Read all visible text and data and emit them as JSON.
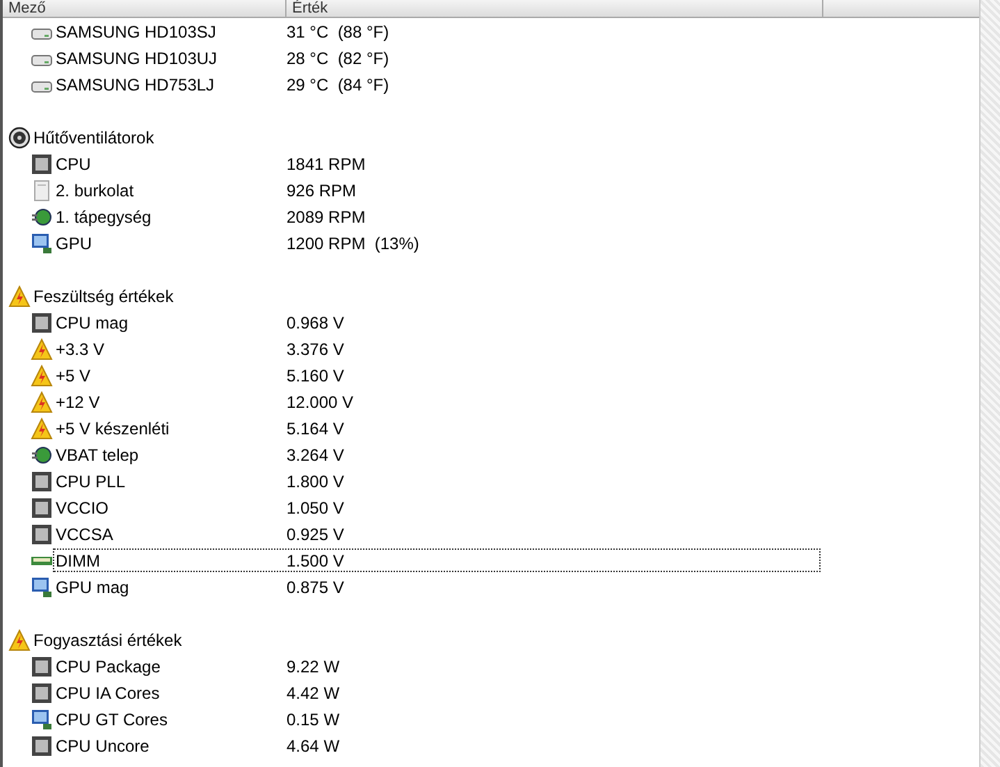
{
  "columns": [
    "Mező",
    "Érték"
  ],
  "groups": [
    {
      "items": [
        {
          "kind": "drive",
          "name": "SAMSUNG HD103SJ",
          "value": "31 °C  (88 °F)",
          "focused": false
        },
        {
          "kind": "drive",
          "name": "SAMSUNG HD103UJ",
          "value": "28 °C  (82 °F)",
          "focused": false
        },
        {
          "kind": "drive",
          "name": "SAMSUNG HD753LJ",
          "value": "29 °C  (84 °F)",
          "focused": false
        }
      ]
    },
    {
      "kind": "fan",
      "label": "Hűtőventilátorok",
      "items": [
        {
          "kind": "chip",
          "name": "CPU",
          "value": "1841 RPM",
          "focused": false
        },
        {
          "kind": "case",
          "name": "2. burkolat",
          "value": "926 RPM",
          "focused": false
        },
        {
          "kind": "plug",
          "name": "1. tápegység",
          "value": "2089 RPM",
          "focused": false
        },
        {
          "kind": "monitor",
          "name": "GPU",
          "value": "1200 RPM  (13%)",
          "focused": false
        }
      ]
    },
    {
      "kind": "warning",
      "label": "Feszültség értékek",
      "items": [
        {
          "kind": "chip",
          "name": "CPU mag",
          "value": "0.968 V",
          "focused": false
        },
        {
          "kind": "warning",
          "name": "+3.3 V",
          "value": "3.376 V",
          "focused": false
        },
        {
          "kind": "warning",
          "name": "+5 V",
          "value": "5.160 V",
          "focused": false
        },
        {
          "kind": "warning",
          "name": "+12 V",
          "value": "12.000 V",
          "focused": false
        },
        {
          "kind": "warning",
          "name": "+5 V készenléti",
          "value": "5.164 V",
          "focused": false
        },
        {
          "kind": "plug",
          "name": "VBAT telep",
          "value": "3.264 V",
          "focused": false
        },
        {
          "kind": "chip",
          "name": "CPU PLL",
          "value": "1.800 V",
          "focused": false
        },
        {
          "kind": "chip",
          "name": "VCCIO",
          "value": "1.050 V",
          "focused": false
        },
        {
          "kind": "chip",
          "name": "VCCSA",
          "value": "0.925 V",
          "focused": false
        },
        {
          "kind": "memory",
          "name": "DIMM",
          "value": "1.500 V",
          "focused": true
        },
        {
          "kind": "monitor",
          "name": "GPU mag",
          "value": "0.875 V",
          "focused": false
        }
      ]
    },
    {
      "kind": "warning",
      "label": "Fogyasztási értékek",
      "items": [
        {
          "kind": "chip",
          "name": "CPU Package",
          "value": "9.22 W",
          "focused": false
        },
        {
          "kind": "chip",
          "name": "CPU IA Cores",
          "value": "4.42 W",
          "focused": false
        },
        {
          "kind": "monitor",
          "name": "CPU GT Cores",
          "value": "0.15 W",
          "focused": false
        },
        {
          "kind": "chip",
          "name": "CPU Uncore",
          "value": "4.64 W",
          "focused": false
        }
      ]
    }
  ]
}
